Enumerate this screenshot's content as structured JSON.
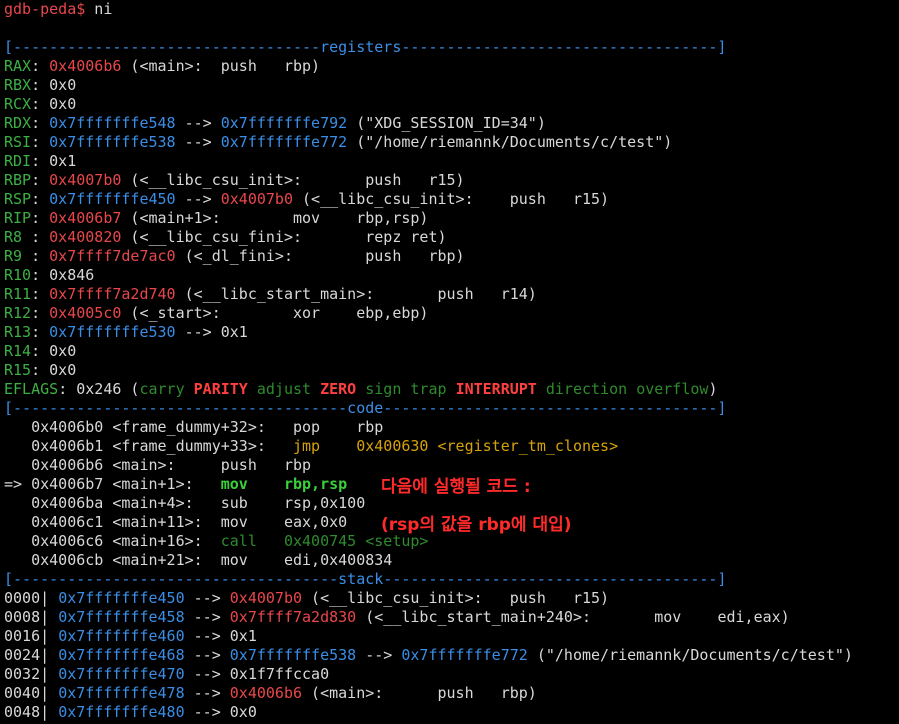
{
  "prompt": {
    "label": "gdb-peda$",
    "command": " ni"
  },
  "sections": {
    "registers": "[----------------------------------registers-----------------------------------]",
    "code": "[-------------------------------------code-------------------------------------]",
    "stack": "[------------------------------------stack-------------------------------------]"
  },
  "registers": [
    {
      "name": "RAX",
      "sep": ": ",
      "val": "0x4006b6",
      "rest": " (<main>:  push   rbp)"
    },
    {
      "name": "RBX",
      "sep": ": ",
      "val": "0x0",
      "rest": ""
    },
    {
      "name": "RCX",
      "sep": ": ",
      "val": "0x0",
      "rest": ""
    },
    {
      "name": "RDX",
      "sep": ": ",
      "val": "0x7fffffffe548",
      "arrow": " --> ",
      "val2": "0x7fffffffe792",
      "rest": " (\"XDG_SESSION_ID=34\")"
    },
    {
      "name": "RSI",
      "sep": ": ",
      "val": "0x7fffffffe538",
      "arrow": " --> ",
      "val2": "0x7fffffffe772",
      "rest": " (\"/home/riemannk/Documents/c/test\")"
    },
    {
      "name": "RDI",
      "sep": ": ",
      "val": "0x1",
      "rest": ""
    },
    {
      "name": "RBP",
      "sep": ": ",
      "val": "0x4007b0",
      "rest": " (<__libc_csu_init>:       push   r15)"
    },
    {
      "name": "RSP",
      "sep": ": ",
      "val": "0x7fffffffe450",
      "arrow": " --> ",
      "val2": "0x4007b0",
      "rest": " (<__libc_csu_init>:    push   r15)"
    },
    {
      "name": "RIP",
      "sep": ": ",
      "val": "0x4006b7",
      "rest": " (<main+1>:        mov    rbp,rsp)"
    },
    {
      "name": "R8 ",
      "sep": ": ",
      "val": "0x400820",
      "rest": " (<__libc_csu_fini>:       repz ret)"
    },
    {
      "name": "R9 ",
      "sep": ": ",
      "val": "0x7ffff7de7ac0",
      "rest": " (<_dl_fini>:        push   rbp)"
    },
    {
      "name": "R10",
      "sep": ": ",
      "val": "0x846",
      "rest": ""
    },
    {
      "name": "R11",
      "sep": ": ",
      "val": "0x7ffff7a2d740",
      "rest": " (<__libc_start_main>:       push   r14)"
    },
    {
      "name": "R12",
      "sep": ": ",
      "val": "0x4005c0",
      "rest": " (<_start>:        xor    ebp,ebp)"
    },
    {
      "name": "R13",
      "sep": ": ",
      "val": "0x7fffffffe530",
      "arrow": " --> ",
      "val2": "0x1",
      "rest": ""
    },
    {
      "name": "R14",
      "sep": ": ",
      "val": "0x0",
      "rest": ""
    },
    {
      "name": "R15",
      "sep": ": ",
      "val": "0x0",
      "rest": ""
    }
  ],
  "eflags": {
    "name": "EFLAGS",
    "value": ": 0x246 (",
    "flags": [
      {
        "t": "carry",
        "on": false
      },
      {
        "t": "PARITY",
        "on": true
      },
      {
        "t": "adjust",
        "on": false
      },
      {
        "t": "ZERO",
        "on": true
      },
      {
        "t": "sign",
        "on": false
      },
      {
        "t": "trap",
        "on": false
      },
      {
        "t": "INTERRUPT",
        "on": true
      },
      {
        "t": "direction",
        "on": false
      },
      {
        "t": "overflow",
        "on": false
      }
    ],
    "close": ")"
  },
  "code": [
    {
      "prefix": "   ",
      "addr": "0x4006b0",
      "sym": " <frame_dummy+32>:   ",
      "op": "pop",
      "args": "    rbp",
      "style": "normal"
    },
    {
      "prefix": "   ",
      "addr": "0x4006b1",
      "sym": " <frame_dummy+33>:   ",
      "op": "jmp",
      "args": "    0x400630 <register_tm_clones>",
      "style": "jump"
    },
    {
      "prefix": "   ",
      "addr": "0x4006b6",
      "sym": " <main>:     ",
      "op": "push",
      "args": "   rbp",
      "style": "normal"
    },
    {
      "prefix": "=> ",
      "addr": "0x4006b7",
      "sym": " <main+1>:   ",
      "op": "mov",
      "args": "    rbp,rsp",
      "style": "current"
    },
    {
      "prefix": "   ",
      "addr": "0x4006ba",
      "sym": " <main+4>:   ",
      "op": "sub",
      "args": "    rsp,0x100",
      "style": "normal"
    },
    {
      "prefix": "   ",
      "addr": "0x4006c1",
      "sym": " <main+11>:  ",
      "op": "mov",
      "args": "    eax,0x0",
      "style": "normal"
    },
    {
      "prefix": "   ",
      "addr": "0x4006c6",
      "sym": " <main+16>:  ",
      "op": "call",
      "args": "   0x400745 <setup>",
      "style": "call"
    },
    {
      "prefix": "   ",
      "addr": "0x4006cb",
      "sym": " <main+21>:  ",
      "op": "mov",
      "args": "    edi,0x400834",
      "style": "normal"
    }
  ],
  "stack": [
    {
      "off": "0000| ",
      "addr": "0x7fffffffe450",
      "arrow": " --> ",
      "val": "0x4007b0",
      "valc": "r",
      "rest": " (<__libc_csu_init>:   push   r15)"
    },
    {
      "off": "0008| ",
      "addr": "0x7fffffffe458",
      "arrow": " --> ",
      "val": "0x7ffff7a2d830",
      "valc": "r",
      "rest": " (<__libc_start_main+240>:       mov    edi,eax)"
    },
    {
      "off": "0016| ",
      "addr": "0x7fffffffe460",
      "arrow": " --> ",
      "val": "0x1",
      "valc": "w",
      "rest": ""
    },
    {
      "off": "0024| ",
      "addr": "0x7fffffffe468",
      "arrow": " --> ",
      "val": "0x7fffffffe538",
      "valc": "b",
      "rest": " --> ",
      "val2": "0x7fffffffe772",
      "rest2": " (\"/home/riemannk/Documents/c/test\")"
    },
    {
      "off": "0032| ",
      "addr": "0x7fffffffe470",
      "arrow": " --> ",
      "val": "0x1f7ffcca0",
      "valc": "w",
      "rest": ""
    },
    {
      "off": "0040| ",
      "addr": "0x7fffffffe478",
      "arrow": " --> ",
      "val": "0x4006b6",
      "valc": "r",
      "rest": " (<main>:      push   rbp)"
    },
    {
      "off": "0048| ",
      "addr": "0x7fffffffe480",
      "arrow": " --> ",
      "val": "0x0",
      "valc": "w",
      "rest": ""
    }
  ],
  "annotation": {
    "line1": "다음에 실행될 코드 :",
    "line2": "(rsp의 값을 rbp에 대입)"
  }
}
